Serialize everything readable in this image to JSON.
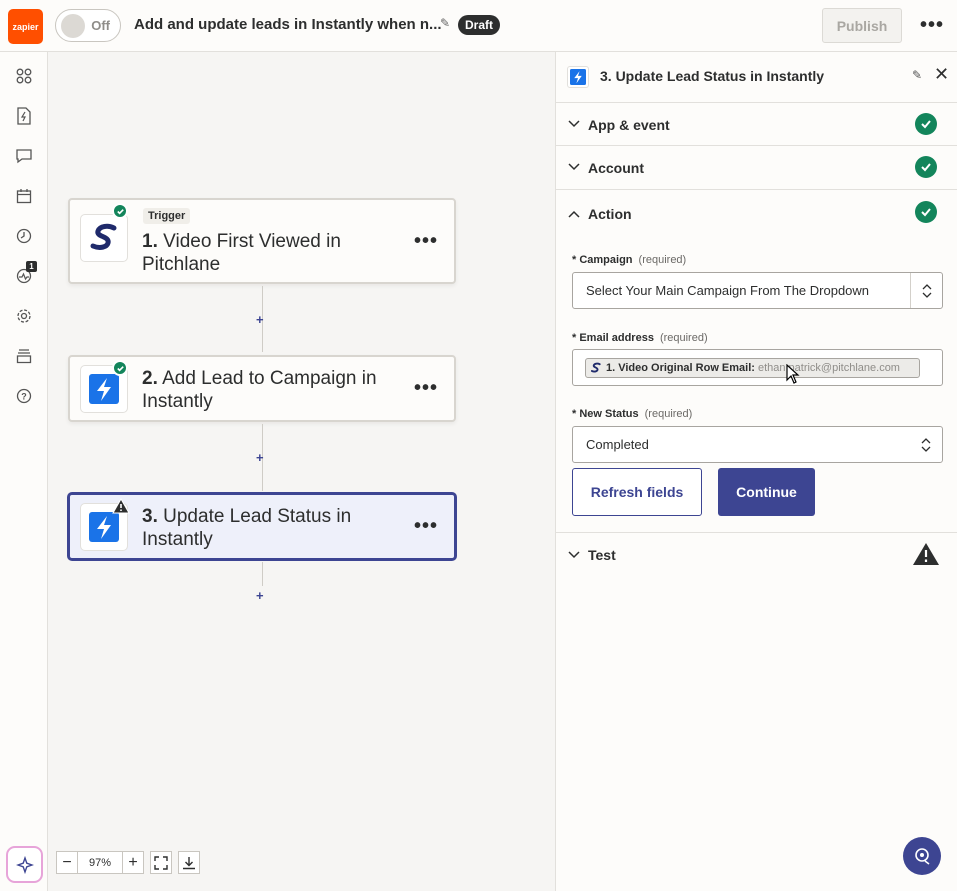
{
  "header": {
    "logo_text": "zapier",
    "toggle_label": "Off",
    "zap_title": "Add and update leads in Instantly when n...",
    "status_badge": "Draft",
    "publish_label": "Publish"
  },
  "sidebar": {
    "notification_count": "1",
    "icons": [
      "apps-icon",
      "zap-file-icon",
      "comment-icon",
      "calendar-icon",
      "history-icon",
      "activity-icon",
      "settings-icon",
      "layers-icon",
      "help-icon"
    ]
  },
  "steps": [
    {
      "tag": "Trigger",
      "number": "1.",
      "title": "Video First Viewed in Pitchlane",
      "title_line1": "Video First Viewed in",
      "title_line2": "Pitchlane",
      "status": "complete"
    },
    {
      "number": "2.",
      "title_line1": "Add Lead to Campaign in",
      "title_line2": "Instantly",
      "status": "complete"
    },
    {
      "number": "3.",
      "title_line1": "Update Lead Status in",
      "title_line2": "Instantly",
      "status": "warning"
    }
  ],
  "zoom": {
    "value": "97%"
  },
  "panel": {
    "title": "3. Update Lead Status in Instantly",
    "sections": {
      "app_event": "App & event",
      "account": "Account",
      "action": "Action",
      "test": "Test"
    },
    "fields": {
      "campaign": {
        "label": "Campaign",
        "required": "(required)",
        "value": "Select Your Main Campaign From The Dropdown"
      },
      "email": {
        "label": "Email address",
        "required": "(required)",
        "pill_name": "1. Video Original Row Email:",
        "pill_value": "ethan.patrick@pitchlane.com"
      },
      "status": {
        "label": "New Status",
        "required": "(required)",
        "value": "Completed"
      }
    },
    "refresh_label": "Refresh fields",
    "continue_label": "Continue"
  },
  "colors": {
    "brand": "#ff4f00",
    "accent": "#3d4592",
    "success": "#13855b"
  }
}
